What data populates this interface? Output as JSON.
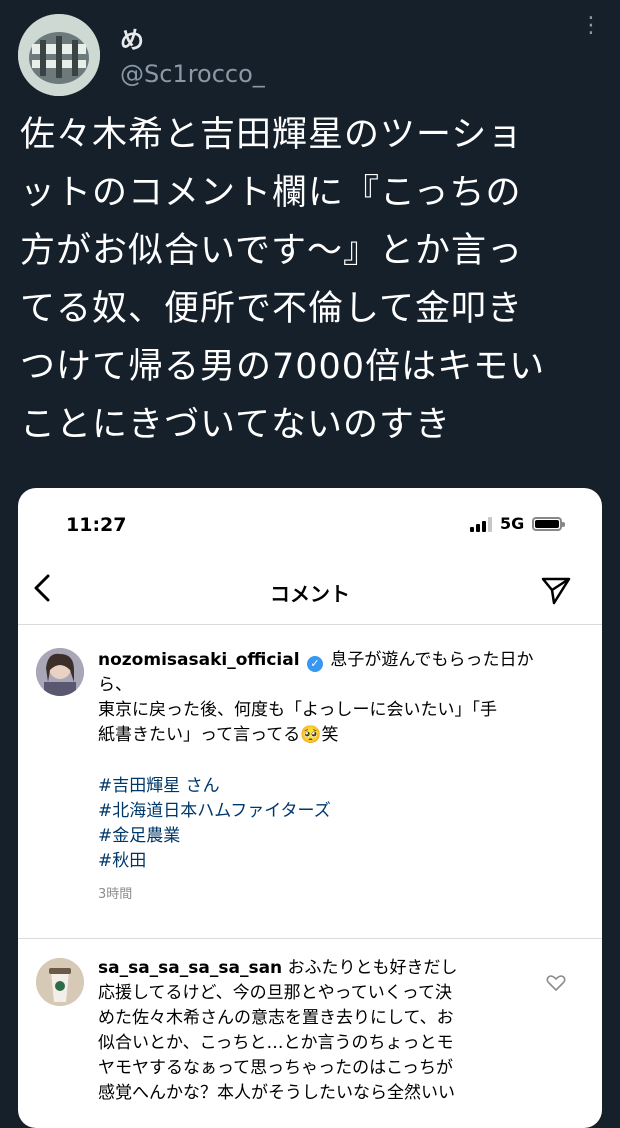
{
  "tweet": {
    "display_name": "め",
    "handle": "@Sc1rocco_",
    "more_glyph": "⋮",
    "lines": [
      "佐々木希と吉田輝星のツーショ",
      "ットのコメント欄に『こっちの",
      "方がお似合いです〜』とか言っ",
      "てる奴、便所で不倫して金叩き",
      "つけて帰る男の7000倍はキモい",
      "ことにきづいてないのすき"
    ]
  },
  "screenshot": {
    "status_time": "11:27",
    "network": "5G",
    "title": "コメント",
    "comments": [
      {
        "username": "nozomisasaki_official",
        "verified_glyph": "✓",
        "text_lines": [
          "息子が遊んでもらった日か",
          "ら、",
          "東京に戻った後、何度も「よっしーに会いたい」「手",
          "紙書きたい」って言ってる🥺笑"
        ],
        "hashtags": [
          "#吉田輝星 さん",
          "#北海道日本ハムファイターズ",
          "#金足農業",
          "#秋田"
        ],
        "time": "3時間"
      },
      {
        "username": "sa_sa_sa_sa_sa_san",
        "text_lines": [
          "おふたりとも好きだし",
          "応援してるけど、今の旦那とやっていくって決",
          "めた佐々木希さんの意志を置き去りにして、お",
          "似合いとか、こっちと…とか言うのちょっとモ",
          "ヤモヤするなぁって思っちゃったのはこっちが",
          "感覚へんかな？本人がそうしたいなら全然いい"
        ]
      }
    ]
  }
}
